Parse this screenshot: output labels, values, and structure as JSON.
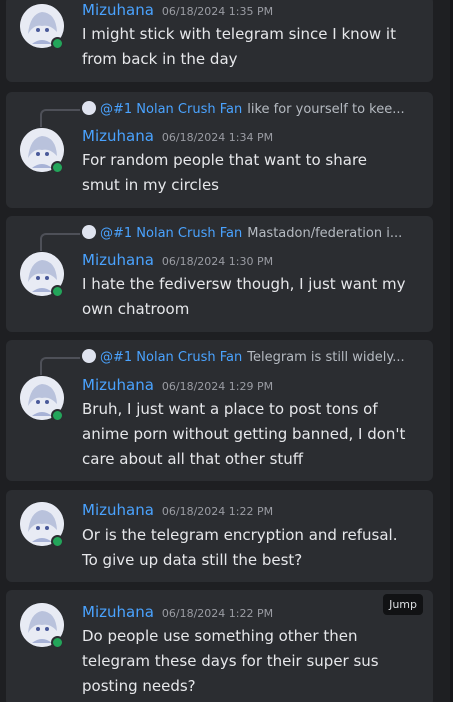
{
  "messages": [
    {
      "username": "Mizuhana",
      "timestamp": "06/18/2024 1:35 PM",
      "lines": [
        "I might stick with telegram since I know it",
        "from back in the day"
      ]
    },
    {
      "reply": {
        "name": "@#1 Nolan Crush Fan",
        "preview": "like for yourself to kee..."
      },
      "username": "Mizuhana",
      "timestamp": "06/18/2024 1:34 PM",
      "lines": [
        "For random people that want to share",
        "smut in my circles"
      ]
    },
    {
      "reply": {
        "name": "@#1 Nolan Crush Fan",
        "preview": "Mastadon/federation i..."
      },
      "username": "Mizuhana",
      "timestamp": "06/18/2024 1:30 PM",
      "lines": [
        "I hate the fediversw though, I just want my",
        "own chatroom"
      ]
    },
    {
      "reply": {
        "name": "@#1 Nolan Crush Fan",
        "preview": "Telegram is still widely..."
      },
      "username": "Mizuhana",
      "timestamp": "06/18/2024 1:29 PM",
      "lines": [
        "Bruh, I just want a place to post tons of",
        "anime porn without getting banned, I don't",
        "care about all that other stuff"
      ]
    },
    {
      "username": "Mizuhana",
      "timestamp": "06/18/2024 1:22 PM",
      "lines": [
        "Or is the telegram encryption and refusal.",
        "To give up data still the best?"
      ]
    },
    {
      "username": "Mizuhana",
      "timestamp": "06/18/2024 1:22 PM",
      "lines": [
        "Do people use something other then",
        "telegram these days for their super sus",
        "posting needs?"
      ],
      "jump_label": "Jump"
    }
  ]
}
